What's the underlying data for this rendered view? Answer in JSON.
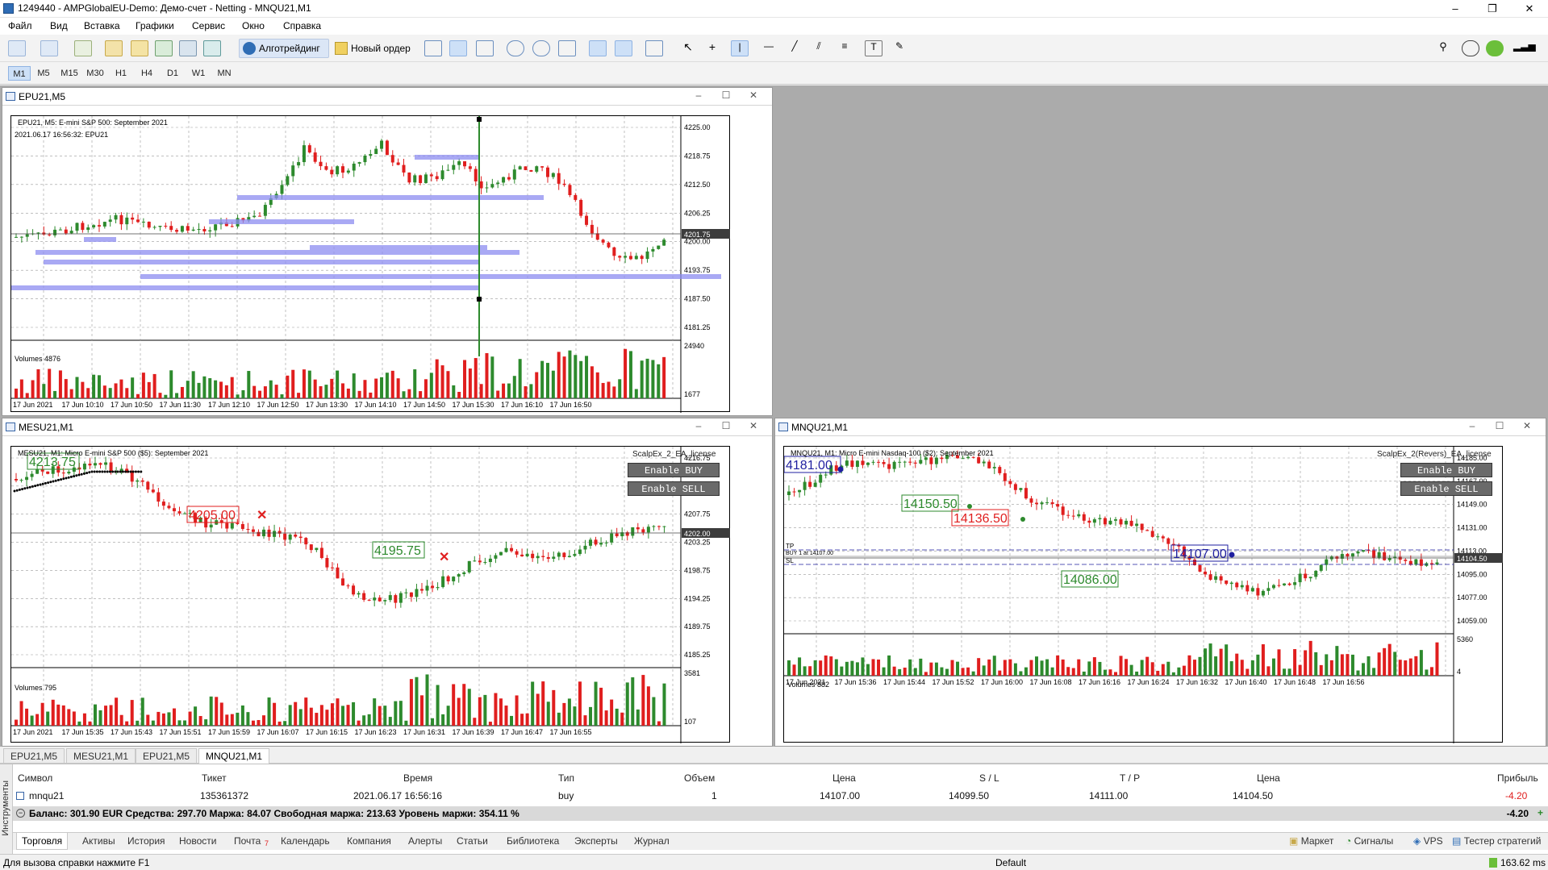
{
  "window": {
    "title": "1249440 - AMPGlobalEU-Demo: Демо-счет - Netting - MNQU21,M1",
    "buttons": [
      "–",
      "❐",
      "✕"
    ]
  },
  "menu": [
    "Файл",
    "Вид",
    "Вставка",
    "Графики",
    "Сервис",
    "Окно",
    "Справка"
  ],
  "toolbar": {
    "algotrading_label": "Алготрейдинг",
    "new_order_label": "Новый ордер"
  },
  "timeframes": [
    "M1",
    "M5",
    "M15",
    "M30",
    "H1",
    "H4",
    "D1",
    "W1",
    "MN"
  ],
  "active_timeframe": "M1",
  "charts": {
    "epu": {
      "caption": "EPU21,M5",
      "header1": "EPU21, M5:  E-mini S&P 500: September 2021",
      "header2": "2021.06.17 16:56:32: EPU21",
      "price_labels": [
        "4225.00",
        "4218.75",
        "4212.50",
        "4206.25",
        "4200.00",
        "4193.75",
        "4187.50",
        "4181.25"
      ],
      "current_price": "4201.75",
      "volume_label": "Volumes 4876",
      "volume_scale": [
        "24940",
        "1677"
      ],
      "time_labels": [
        "17 Jun 2021",
        "17 Jun 10:10",
        "17 Jun 10:50",
        "17 Jun 11:30",
        "17 Jun 12:10",
        "17 Jun 12:50",
        "17 Jun 13:30",
        "17 Jun 14:10",
        "17 Jun 14:50",
        "17 Jun 15:30",
        "17 Jun 16:10",
        "17 Jun 16:50"
      ]
    },
    "mesu": {
      "caption": "MESU21,M1",
      "header1": "MESU21, M1:  Micro E-mini S&P 500 ($5): September 2021",
      "ea_label": "ScalpEx_2_EA_license",
      "enable_buy": "Enable BUY",
      "enable_sell": "Enable SELL",
      "price_labels": [
        "4216.75",
        "4212.25",
        "4207.75",
        "4203.25",
        "4198.75",
        "4194.25",
        "4189.75",
        "4185.25"
      ],
      "current_price": "4202.00",
      "marker1": "4213.75",
      "marker2": "4205.00",
      "marker3": "4195.75",
      "volume_label": "Volumes 795",
      "volume_scale": [
        "3581",
        "107"
      ],
      "time_labels": [
        "17 Jun 2021",
        "17 Jun 15:35",
        "17 Jun 15:43",
        "17 Jun 15:51",
        "17 Jun 15:59",
        "17 Jun 16:07",
        "17 Jun 16:15",
        "17 Jun 16:23",
        "17 Jun 16:31",
        "17 Jun 16:39",
        "17 Jun 16:47",
        "17 Jun 16:55"
      ]
    },
    "mnqu": {
      "caption": "MNQU21,M1",
      "header1": "MNQU21, M1:  Micro E-mini Nasdaq-100 ($2): September 2021",
      "ea_label": "ScalpEx_2(Revers)_EA_license",
      "enable_buy": "Enable BUY",
      "enable_sell": "Enable SELL",
      "price_labels": [
        "14185.00",
        "14167.00",
        "14149.00",
        "14131.00",
        "14113.00",
        "14095.00",
        "14077.00",
        "14059.00"
      ],
      "current_price": "14104.50",
      "tp_label": "TP",
      "sl_label": "SL",
      "position_label": "BUY 1 at 14107.00",
      "marker1": "4181.00",
      "marker2": "14150.50",
      "marker3": "14136.50",
      "marker4": "14086.00",
      "marker5": "14107.00",
      "volume_label": "Volumes 882",
      "volume_scale": [
        "5360",
        "4"
      ],
      "time_labels": [
        "17 Jun 2021",
        "17 Jun 15:36",
        "17 Jun 15:44",
        "17 Jun 15:52",
        "17 Jun 16:00",
        "17 Jun 16:08",
        "17 Jun 16:16",
        "17 Jun 16:24",
        "17 Jun 16:32",
        "17 Jun 16:40",
        "17 Jun 16:48",
        "17 Jun 16:56"
      ]
    }
  },
  "chart_tabs": [
    "EPU21,M5",
    "MESU21,M1",
    "EPU21,M5",
    "MNQU21,M1"
  ],
  "active_chart_tab": "MNQU21,M1",
  "terminal": {
    "side_label": "Инструменты",
    "columns": [
      "Символ",
      "Тикет",
      "Время",
      "Тип",
      "Объем",
      "Цена",
      "S / L",
      "T / P",
      "Цена",
      "Прибыль"
    ],
    "row": {
      "symbol": "mnqu21",
      "ticket": "135361372",
      "time": "2021.06.17 16:56:16",
      "type": "buy",
      "volume": "1",
      "price": "14107.00",
      "sl": "14099.50",
      "tp": "14111.00",
      "current": "14104.50",
      "profit": "-4.20"
    },
    "balance_line": "Баланс: 301.90 EUR  Средства: 297.70  Маржа: 84.07  Свободная маржа: 213.63  Уровень маржи: 354.11 %",
    "total_profit": "-4.20",
    "tabs": [
      "Торговля",
      "Активы",
      "История",
      "Новости",
      "Почта",
      "Календарь",
      "Компания",
      "Алерты",
      "Статьи",
      "Библиотека",
      "Эксперты",
      "Журнал"
    ],
    "mail_badge": "7",
    "right_tabs": [
      "Маркет",
      "Сигналы",
      "VPS",
      "Тестер стратегий"
    ]
  },
  "status": {
    "help": "Для вызова справки нажмите F1",
    "profile": "Default",
    "ping": "163.62 ms"
  },
  "colors": {
    "bull": "#2d8a2d",
    "bear": "#e01e1e",
    "level": "#8c8cf0",
    "accent": "#3a7bd5"
  }
}
